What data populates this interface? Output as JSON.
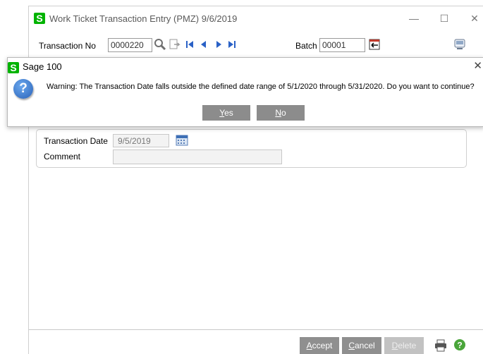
{
  "window": {
    "title": "Work Ticket Transaction Entry (PMZ) 9/6/2019",
    "logo": "S",
    "controls": {
      "minimize": "—",
      "maximize": "☐",
      "close": "✕"
    }
  },
  "header": {
    "transaction_label": "Transaction No",
    "transaction_value": "0000220",
    "batch_label": "Batch",
    "batch_value": "00001"
  },
  "fields": {
    "date_label": "Transaction Date",
    "date_value": "9/5/2019",
    "comment_label": "Comment",
    "comment_value": ""
  },
  "footer": {
    "accept": "ccept",
    "accept_key": "A",
    "cancel": "ancel",
    "cancel_key": "C",
    "delete": "elete",
    "delete_key": "D"
  },
  "dialog": {
    "title": "Sage 100",
    "logo": "S",
    "close": "✕",
    "message": "Warning: The Transaction Date falls outside the defined date range of 5/1/2020 through 5/31/2020. Do you want to continue?",
    "yes_key": "Y",
    "yes": "es",
    "no_key": "N",
    "no": "o"
  },
  "icons": [
    "search-icon",
    "copy-icon",
    "first-record-icon",
    "previous-record-icon",
    "next-record-icon",
    "last-record-icon",
    "batch-icon",
    "calendar-icon",
    "printer-icon",
    "help-icon",
    "question-icon",
    "panel-icon"
  ],
  "colors": {
    "accent": "#00b300",
    "button": "#8f8f8f",
    "button_disabled": "#c2c2c2",
    "nav": "#2a61c6"
  }
}
